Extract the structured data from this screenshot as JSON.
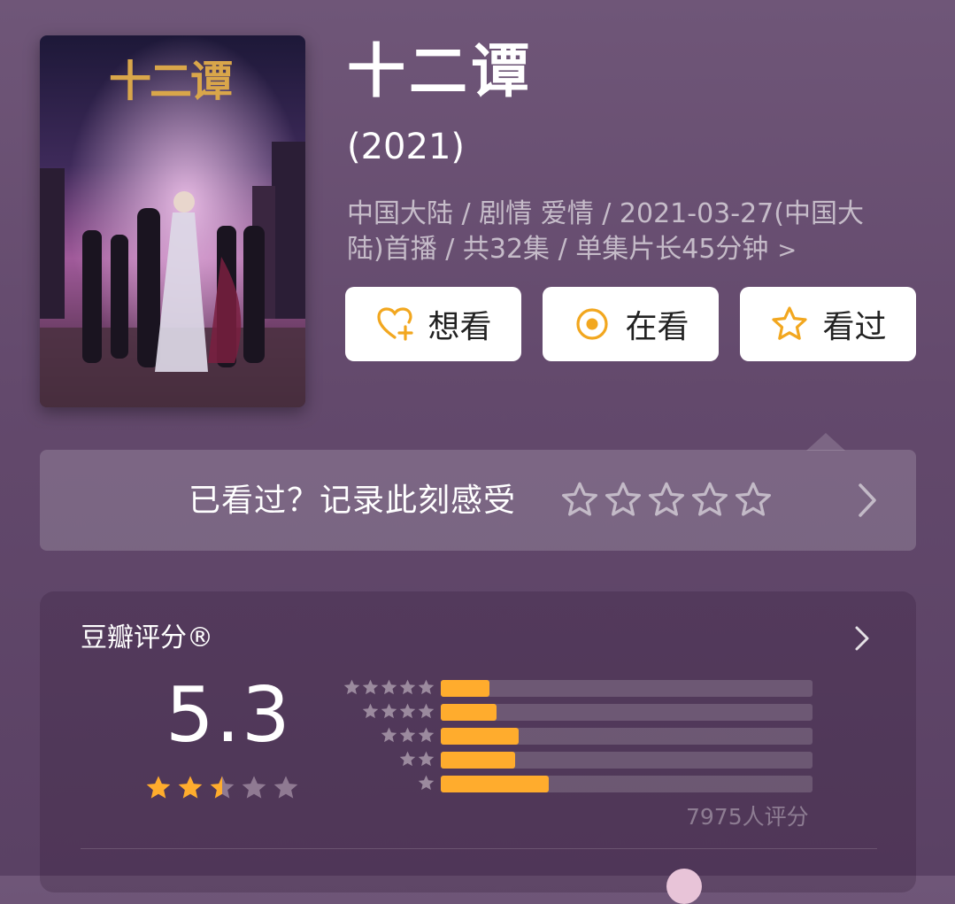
{
  "colors": {
    "background": "#674e70",
    "accent": "#ffac2d",
    "button_bg": "#ffffff",
    "star_empty": "#8f7a92"
  },
  "poster": {
    "title_art": "十二谭",
    "icon": "poster-image"
  },
  "movie": {
    "title": "十二谭",
    "year": "(2021)",
    "meta_line1": "中国大陆 / 剧情 爱情 / 2021-03-27(中国大",
    "meta_line2": "陆)首播 / 共32集 / 单集片长45分钟",
    "meta_chevron": ">"
  },
  "actions": [
    {
      "label": "想看",
      "icon": "heart-plus-icon"
    },
    {
      "label": "在看",
      "icon": "target-circle-icon"
    },
    {
      "label": "看过",
      "icon": "star-outline-icon"
    }
  ],
  "rate_prompt": {
    "label": "已看过？记录此刻感受",
    "star_count": 5,
    "chevron_icon": "chevron-right-icon"
  },
  "rating": {
    "title": "豆瓣评分®",
    "score": "5.3",
    "stars": 2.5,
    "raters": "7975人评分",
    "distribution": [
      {
        "stars": 5,
        "fraction": 0.13
      },
      {
        "stars": 4,
        "fraction": 0.15
      },
      {
        "stars": 3,
        "fraction": 0.21
      },
      {
        "stars": 2,
        "fraction": 0.2
      },
      {
        "stars": 1,
        "fraction": 0.29
      }
    ]
  }
}
